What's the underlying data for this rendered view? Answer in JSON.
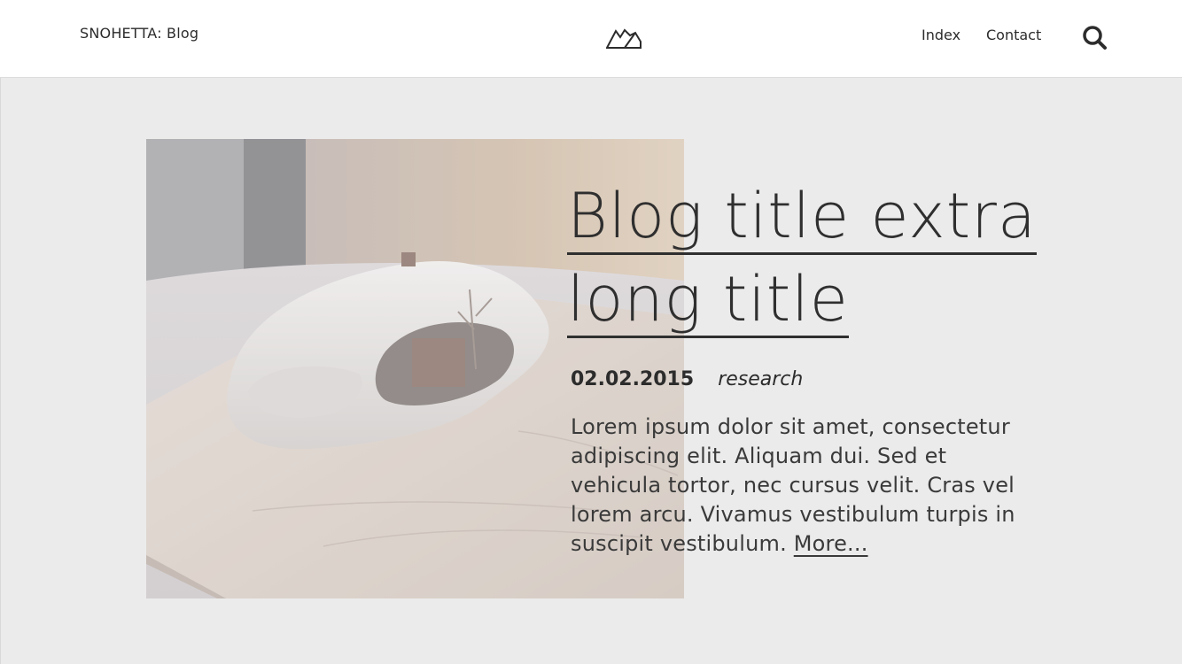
{
  "header": {
    "site_title": "SNOHETTA: Blog",
    "logo_icon": "mountain-logo-icon",
    "nav": [
      {
        "label": "Index"
      },
      {
        "label": "Contact"
      }
    ],
    "search_icon": "search-icon"
  },
  "post": {
    "title_line1": "Blog title extra",
    "title_line2": "long title",
    "date": "02.02.2015",
    "tag": "research",
    "excerpt": "Lorem ipsum dolor sit amet, consectetur adipiscing elit. Aliquam dui. Sed et vehicula tortor, nec cursus velit. Cras vel lorem arcu. Vivamus vestibulum turpis in suscipit vestibulum.",
    "more_label": "More...",
    "image_icon": "architecture-model-image"
  },
  "colors": {
    "background": "#ebebeb",
    "header_bg": "#ffffff",
    "text": "#2c2c2c"
  }
}
